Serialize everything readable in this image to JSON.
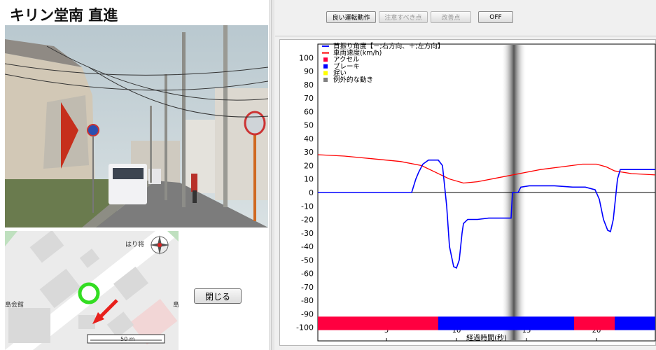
{
  "left": {
    "title": "キリン堂南 直進",
    "close_label": "閉じる",
    "map": {
      "label_hari": "はり将",
      "label_shimakaikan": "島会館",
      "label_right": "島",
      "scale_label": "50 m"
    }
  },
  "toolbar": {
    "good_label": "良い運転動作",
    "caution_label": "注意すべき点",
    "improve_label": "改善点",
    "off_label": "OFF"
  },
  "colors": {
    "heading": "#0000ff",
    "speed": "#ff0000",
    "accel": "#ff0040",
    "brake": "#0000ff",
    "slow": "#ffff00",
    "exception": "#808080"
  },
  "chart_data": {
    "type": "line",
    "xlabel": "経過時間(秒)",
    "ylabel": "",
    "xlim": [
      0.1,
      24.2
    ],
    "ylim": [
      -110,
      110
    ],
    "xticks": [
      5,
      10,
      15,
      20
    ],
    "yticks": [
      100,
      90,
      80,
      70,
      60,
      50,
      40,
      30,
      20,
      10,
      0,
      -10,
      -20,
      -30,
      -40,
      -50,
      -60,
      -70,
      -80,
      -90,
      -100
    ],
    "legend": [
      {
        "label": "首振り角度【－;右方向、＋;左方向】",
        "color": "#0000ff",
        "kind": "line"
      },
      {
        "label": "車両速度(km/h)",
        "color": "#ff0000",
        "kind": "line"
      },
      {
        "label": "アクセル",
        "color": "#ff0040",
        "kind": "box"
      },
      {
        "label": "ブレーキ",
        "color": "#0000ff",
        "kind": "box"
      },
      {
        "label": "遅い",
        "color": "#ffff00",
        "kind": "box"
      },
      {
        "label": "例外的な動き",
        "color": "#808080",
        "kind": "box"
      }
    ],
    "series": [
      {
        "name": "首振り角度【－;右方向、＋;左方向】",
        "x": [
          0.1,
          6.8,
          7.1,
          7.3,
          7.6,
          8.0,
          8.7,
          9.0,
          9.3,
          9.5,
          9.8,
          10.0,
          10.2,
          10.4,
          10.5,
          10.8,
          11.5,
          12.3,
          13.9,
          14.0,
          14.3,
          14.4,
          14.6,
          15.2,
          17.0,
          18.3,
          19.2,
          19.9,
          20.2,
          20.5,
          20.8,
          21.0,
          21.2,
          21.4,
          21.5,
          21.7,
          22.0,
          24.2
        ],
        "values": [
          0,
          0,
          10,
          15,
          21,
          24,
          24,
          20,
          -10,
          -40,
          -55,
          -56,
          -50,
          -30,
          -23,
          -20,
          -20,
          -19,
          -19,
          0,
          0,
          0,
          4,
          5,
          5,
          4,
          4,
          2,
          -5,
          -20,
          -28,
          -29,
          -20,
          0,
          10,
          17,
          17,
          17
        ]
      },
      {
        "name": "車両速度(km/h)",
        "x": [
          0.1,
          2,
          4,
          6,
          7.5,
          8.5,
          9.5,
          10.5,
          11.5,
          13,
          14.5,
          16,
          17.5,
          19,
          20,
          20.7,
          21.3,
          22.5,
          24.2
        ],
        "values": [
          28,
          27,
          25,
          23,
          20,
          15,
          10,
          7,
          8,
          11,
          14,
          17,
          19,
          21,
          21,
          19,
          16,
          14,
          13
        ]
      }
    ],
    "bars": [
      {
        "label": "アクセル",
        "from": 0.1,
        "to": 8.7,
        "color": "#ff0040"
      },
      {
        "label": "ブレーキ",
        "from": 8.7,
        "to": 18.4,
        "color": "#0000ff"
      },
      {
        "label": "アクセル",
        "from": 18.4,
        "to": 21.3,
        "color": "#ff0040"
      },
      {
        "label": "ブレーキ",
        "from": 21.3,
        "to": 24.2,
        "color": "#0000ff"
      }
    ],
    "cursor_x": 14.1
  }
}
